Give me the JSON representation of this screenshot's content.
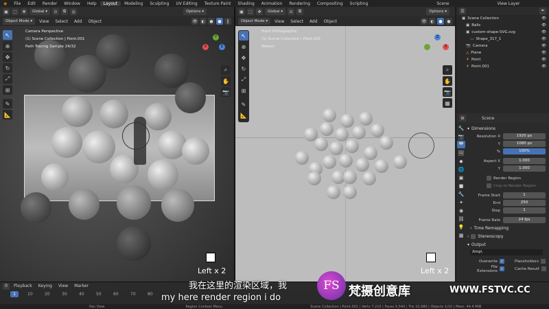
{
  "menu": {
    "items": [
      "File",
      "Edit",
      "Render",
      "Window",
      "Help"
    ],
    "workspaces": [
      "Layout",
      "Modeling",
      "Sculpting",
      "UV Editing",
      "Texture Paint",
      "Shading",
      "Animation",
      "Rendering",
      "Compositing",
      "Scripting"
    ],
    "scene_label": "Scene",
    "view_layer_label": "View Layer"
  },
  "left_vp": {
    "mode": "Object Mode",
    "menus": [
      "View",
      "Select",
      "Add",
      "Object"
    ],
    "orientation": "Global",
    "options": "Options",
    "overlay_lines": [
      "Camera Perspective",
      "(1) Scene Collection | Point.001",
      "Path Tracing Sample 24/32"
    ],
    "bottom_label": "Left x 2"
  },
  "right_vp": {
    "mode": "Object Mode",
    "menus": [
      "View",
      "Select",
      "Add",
      "Object"
    ],
    "orientation": "Global",
    "options": "Options",
    "overlay_lines": [
      "Front Orthographic",
      "(1) Scene Collection | Point.001",
      "Meters"
    ],
    "bottom_label": "Left x 2"
  },
  "gizmo": {
    "x": "X",
    "y": "Y",
    "z": "Z"
  },
  "outliner": {
    "items": [
      {
        "label": "Scene Collection",
        "indent": 0,
        "icon": "collection-icon"
      },
      {
        "label": "Balls",
        "indent": 1,
        "icon": "collection-icon"
      },
      {
        "label": "custom-shape-SVG.svg",
        "indent": 1,
        "icon": "collection-icon"
      },
      {
        "label": "Shape_317_1",
        "indent": 2,
        "icon": "curve-icon"
      },
      {
        "label": "Camera",
        "indent": 1,
        "icon": "camera-icon"
      },
      {
        "label": "Plane",
        "indent": 1,
        "icon": "mesh-icon"
      },
      {
        "label": "Point",
        "indent": 1,
        "icon": "light-icon"
      },
      {
        "label": "Point.001",
        "indent": 1,
        "icon": "light-icon"
      }
    ]
  },
  "props": {
    "scene_label": "Scene",
    "dimensions": "Dimensions",
    "resolution_x_label": "Resolution X",
    "resolution_x": "1920 px",
    "y_label": "Y",
    "resolution_y": "1080 px",
    "percent_label": "%",
    "percent": "100%",
    "aspect_x_label": "Aspect X",
    "aspect_x": "1.000",
    "aspect_y": "1.000",
    "render_region": "Render Region",
    "crop_region": "Crop to Render Region",
    "frame_start_label": "Frame Start",
    "frame_start": "1",
    "end_label": "End",
    "frame_end": "250",
    "step_label": "Step",
    "frame_step": "1",
    "frame_rate_label": "Frame Rate",
    "frame_rate": "24 fps",
    "time_remapping": "Time Remapping",
    "stereoscopy": "Stereoscopy",
    "output": "Output",
    "output_path": "/tmp\\",
    "overwrite": "Overwrite",
    "placeholders": "Placeholders",
    "file_extensions": "File Extensions",
    "cache_result": "Cache Result"
  },
  "timeline": {
    "menus": [
      "Playback",
      "Keying",
      "View",
      "Marker"
    ],
    "current_frame": "1",
    "ticks": [
      "10",
      "20",
      "30",
      "40",
      "50",
      "60",
      "70",
      "80"
    ]
  },
  "status": {
    "left": "Pan View",
    "middle": "Region Context Menu",
    "right": "Scene Collection | Point.001 | Verts 7,210 | Faces 5,540 | Tris 10,980 | Objects 1/10 | Mem: 44.4 MiB"
  },
  "subtitles": {
    "chinese": "我在这里的渲染区域，我",
    "english": "my here render region i do"
  },
  "watermark": {
    "text": "梵摄创意库",
    "url": "WWW.FSTVC.CC",
    "logo": "FS"
  },
  "colors": {
    "accent": "#4772b3",
    "gizmo_x": "#e2504f",
    "gizmo_y": "#6da533",
    "gizmo_z": "#4a86d8"
  }
}
